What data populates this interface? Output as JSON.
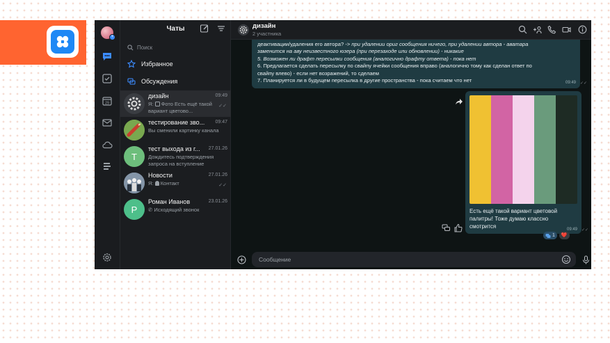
{
  "app": {
    "logo_icon": "app-logo-icon",
    "accent": "#ff6430",
    "brand_blue": "#1e88f5"
  },
  "rail": {
    "icons": [
      "avatar",
      "chat-bubble-icon",
      "task-check-icon",
      "calendar-icon",
      "mail-icon",
      "cloud-icon",
      "lists-icon",
      "settings-gear-icon"
    ],
    "calendar_day": "29"
  },
  "chatlist": {
    "title": "Чаты",
    "search_placeholder": "Поиск",
    "favorites_label": "Избранное",
    "discussions_label": "Обсуждения",
    "chats": [
      {
        "name": "дизайн",
        "time": "09:49",
        "snippet_prefix": "Я:",
        "snippet": "Фото Есть ещё такой вариант цветово...",
        "read": true
      },
      {
        "name": "тестирование зво...",
        "time": "09:47",
        "snippet": "Вы сменили картинку канала",
        "read": false
      },
      {
        "name": "тест выхода из г...",
        "time": "27.01.26",
        "avatar_letter": "Т",
        "snippet": "Дождитесь подтверждения запроса на вступление",
        "read": false
      },
      {
        "name": "Новости",
        "time": "27.01.26",
        "snippet_prefix": "Я:",
        "snippet": "Контакт",
        "read": true
      },
      {
        "name": "Роман Иванов",
        "time": "23.01.26",
        "avatar_letter": "Р",
        "snippet": "Исходящий звонок",
        "read": false
      }
    ]
  },
  "conversation": {
    "title": "дизайн",
    "subtitle": "2 участника",
    "message_top": {
      "line1_normal": "деактивации/удаления его автора? ",
      "line1_italic": "-> при удалении ориг сообщения ничего, при удалении автора - аватара",
      "line2_italic": "заменится на аву неизвестного юзера (при перезаходе или обновлении) - никакие",
      "line3_italic": "5. Возможен ли драфт пересылки сообщения (аналогично драфту ответа) - пока нет",
      "line4": "6. Предлагается сделать пересылку по свайпу ячейки сообщения вправо (аналогично тому как сделан ответ по",
      "line5": "свайпу влево) - если нет возражений, то сделаем",
      "line6": "7. Планируется ли в будущем пересылка в другие пространства - пока считаем что нет",
      "time": "09:49"
    },
    "image_message": {
      "palette": [
        "#f0c132",
        "#d264a4",
        "#f4d3ec",
        "#6a9b7c",
        "#1e2b24"
      ],
      "caption": "Есть ещё такой вариант цветовой палитры! Тоже думаю классно смотрится",
      "time": "09:49"
    },
    "reactions": [
      {
        "emoji": "discussion-icon",
        "count": "1"
      },
      {
        "emoji": "❤️",
        "count": ""
      }
    ],
    "composer_placeholder": "Сообщение"
  }
}
